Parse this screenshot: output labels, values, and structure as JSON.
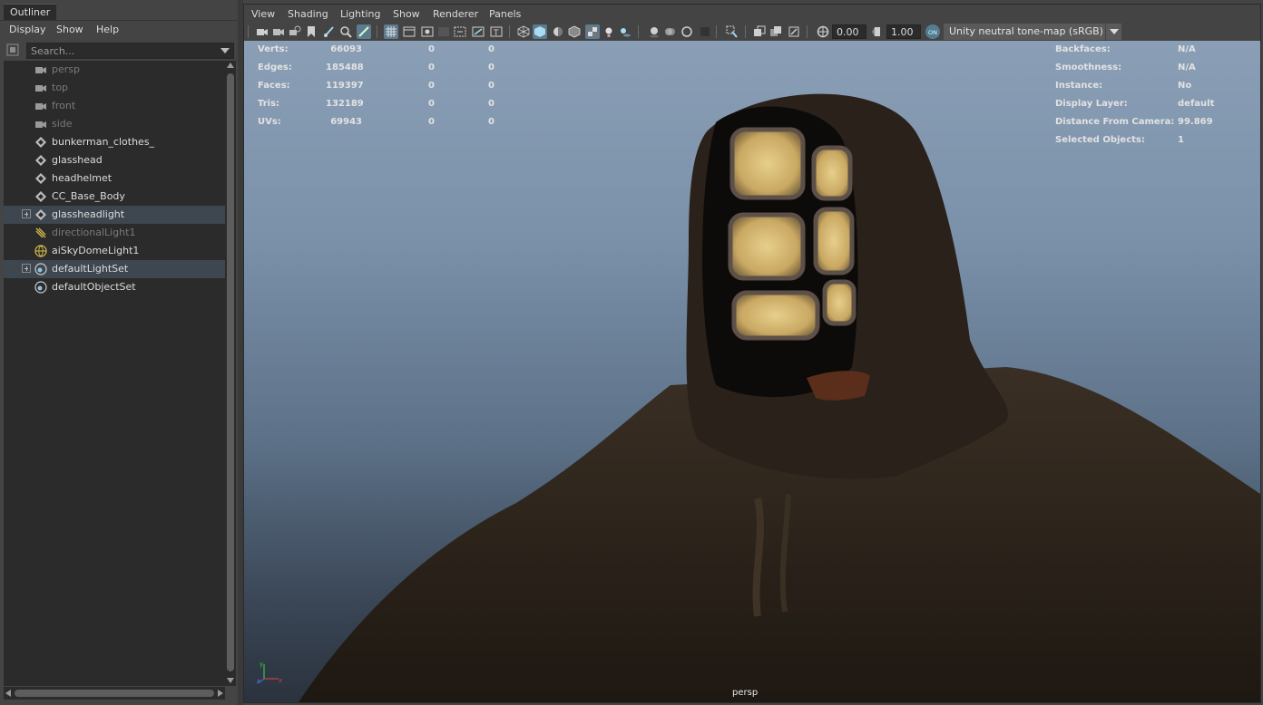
{
  "outliner": {
    "title": "Outliner",
    "menus": [
      "Display",
      "Show",
      "Help"
    ],
    "search_placeholder": "Search...",
    "items": [
      {
        "label": "persp",
        "icon": "camera-icon",
        "dim": true,
        "selected": false,
        "expandable": false
      },
      {
        "label": "top",
        "icon": "camera-icon",
        "dim": true,
        "selected": false,
        "expandable": false
      },
      {
        "label": "front",
        "icon": "camera-icon",
        "dim": true,
        "selected": false,
        "expandable": false
      },
      {
        "label": "side",
        "icon": "camera-icon",
        "dim": true,
        "selected": false,
        "expandable": false
      },
      {
        "label": "bunkerman_clothes_",
        "icon": "mesh-icon",
        "dim": false,
        "selected": false,
        "expandable": false
      },
      {
        "label": "glasshead",
        "icon": "mesh-icon",
        "dim": false,
        "selected": false,
        "expandable": false
      },
      {
        "label": "headhelmet",
        "icon": "mesh-icon",
        "dim": false,
        "selected": false,
        "expandable": false
      },
      {
        "label": "CC_Base_Body",
        "icon": "mesh-icon",
        "dim": false,
        "selected": false,
        "expandable": false
      },
      {
        "label": "glassheadlight",
        "icon": "mesh-icon",
        "dim": false,
        "selected": true,
        "expandable": true
      },
      {
        "label": "directionalLight1",
        "icon": "directional-light-icon",
        "dim": true,
        "selected": false,
        "expandable": false
      },
      {
        "label": "aiSkyDomeLight1",
        "icon": "sky-dome-light-icon",
        "dim": false,
        "selected": false,
        "expandable": false
      },
      {
        "label": "defaultLightSet",
        "icon": "set-icon",
        "dim": false,
        "selected": true,
        "expandable": true
      },
      {
        "label": "defaultObjectSet",
        "icon": "set-icon",
        "dim": false,
        "selected": false,
        "expandable": false
      }
    ]
  },
  "viewport": {
    "menus": [
      "View",
      "Shading",
      "Lighting",
      "Show",
      "Renderer",
      "Panels"
    ],
    "exposure": "0.00",
    "gamma": "1.00",
    "color_management": "Unity neutral tone-map (sRGB)",
    "camera": "persp",
    "hud_left": [
      {
        "label": "Verts:",
        "v1": "66093",
        "v2": "0",
        "v3": "0"
      },
      {
        "label": "Edges:",
        "v1": "185488",
        "v2": "0",
        "v3": "0"
      },
      {
        "label": "Faces:",
        "v1": "119397",
        "v2": "0",
        "v3": "0"
      },
      {
        "label": "Tris:",
        "v1": "132189",
        "v2": "0",
        "v3": "0"
      },
      {
        "label": "UVs:",
        "v1": "69943",
        "v2": "0",
        "v3": "0"
      }
    ],
    "hud_right": [
      {
        "label": "Backfaces:",
        "value": "N/A"
      },
      {
        "label": "Smoothness:",
        "value": "N/A"
      },
      {
        "label": "Instance:",
        "value": "No"
      },
      {
        "label": "Display Layer:",
        "value": "default"
      },
      {
        "label": "Distance From Camera:",
        "value": "99.869"
      },
      {
        "label": "Selected Objects:",
        "value": "1"
      }
    ],
    "colors": {
      "sky_top": "#8a9fb6",
      "sky_bottom": "#2a323d",
      "cloak": "#2f261d",
      "glow": "#d9c07a"
    }
  }
}
